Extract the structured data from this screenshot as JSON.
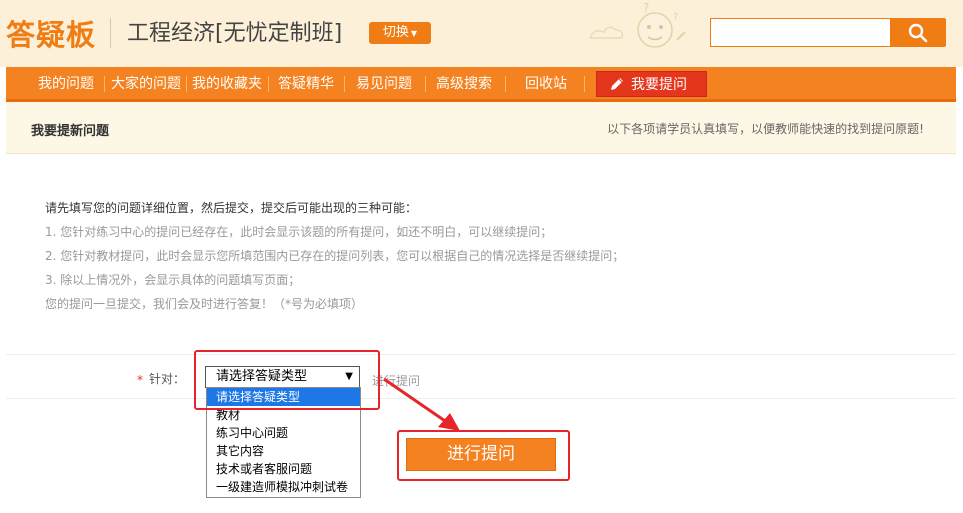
{
  "header": {
    "logo": "答疑板",
    "course_title": "工程经济[无忧定制班]",
    "switch_label": "切换",
    "search_placeholder": ""
  },
  "nav": {
    "items": [
      "我的问题",
      "大家的问题",
      "我的收藏夹",
      "答疑精华",
      "易见问题",
      "高级搜索",
      "回收站"
    ],
    "ask_label": "我要提问"
  },
  "section": {
    "title": "我要提新问题",
    "note": "以下各项请学员认真填写，以便教师能快速的找到提问原题!"
  },
  "instructions": {
    "lead": "请先填写您的问题详细位置，然后提交，提交后可能出现的三种可能：",
    "items": [
      "1. 您针对练习中心的提问已经存在，此时会显示该题的所有提问，如还不明白，可以继续提问；",
      "2. 您针对教材提问，此时会显示您所填范围内已存在的提问列表，您可以根据自己的情况选择是否继续提问；",
      "3. 除以上情况外，会显示具体的问题填写页面；",
      "您的提问一旦提交，我们会及时进行答复！（*号为必填项）"
    ]
  },
  "form": {
    "required_mark": "*",
    "label": "针对：",
    "select_value": "请选择答疑类型",
    "after_label": "进行提问",
    "options": [
      "请选择答疑类型",
      "教材",
      "练习中心问题",
      "其它内容",
      "技术或者客服问题",
      "一级建造师模拟冲刺试卷"
    ],
    "selected_index": 0,
    "submit_label": "进行提问"
  },
  "colors": {
    "brand_orange": "#f58220",
    "ask_red": "#e4361c",
    "annotation_red": "#e62429",
    "dropdown_highlight": "#1e77e6"
  }
}
